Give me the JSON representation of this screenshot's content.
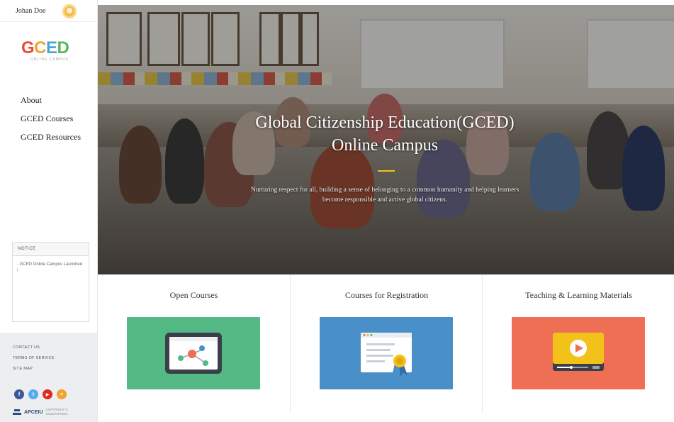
{
  "header": {
    "user_label": "Johan Doe"
  },
  "logo": {
    "text": "GCED",
    "subtitle": "ONLINE CAMPUS"
  },
  "nav": {
    "items": [
      {
        "label": "About"
      },
      {
        "label": "GCED Courses"
      },
      {
        "label": "GCED Resources"
      }
    ]
  },
  "notice": {
    "title": "NOTICE",
    "items": [
      {
        "text": "- GCED Online Campus Launched !"
      }
    ]
  },
  "footer": {
    "links": [
      {
        "label": "CONTACT US"
      },
      {
        "label": "TERMS OF SERVICE"
      },
      {
        "label": "SITE MAP"
      }
    ],
    "socials": [
      {
        "icon": "facebook-icon",
        "glyph": "f",
        "color": "#3b5998"
      },
      {
        "icon": "twitter-icon",
        "glyph": "t",
        "color": "#55acee"
      },
      {
        "icon": "youtube-icon",
        "glyph": "▶",
        "color": "#e02a20"
      },
      {
        "icon": "share-icon",
        "glyph": "<",
        "color": "#f0a22e"
      }
    ],
    "org": "APCEIU",
    "copyright": "COPYRIGHT © GCED/APCEIU"
  },
  "hero": {
    "title_line1": "Global Citizenship Education(GCED)",
    "title_line2": "Online Campus",
    "subtitle": "Nurturing respect for all, building a sense of belonging to a common humanity and helping learners become responsible and active global citizens."
  },
  "cards": [
    {
      "title": "Open Courses",
      "color": "#53b985",
      "icon": "network-tablet-icon"
    },
    {
      "title": "Courses for Registration",
      "color": "#4a90c8",
      "icon": "certificate-icon"
    },
    {
      "title": "Teaching & Learning Materials",
      "color": "#ef6f55",
      "icon": "video-player-icon"
    }
  ]
}
